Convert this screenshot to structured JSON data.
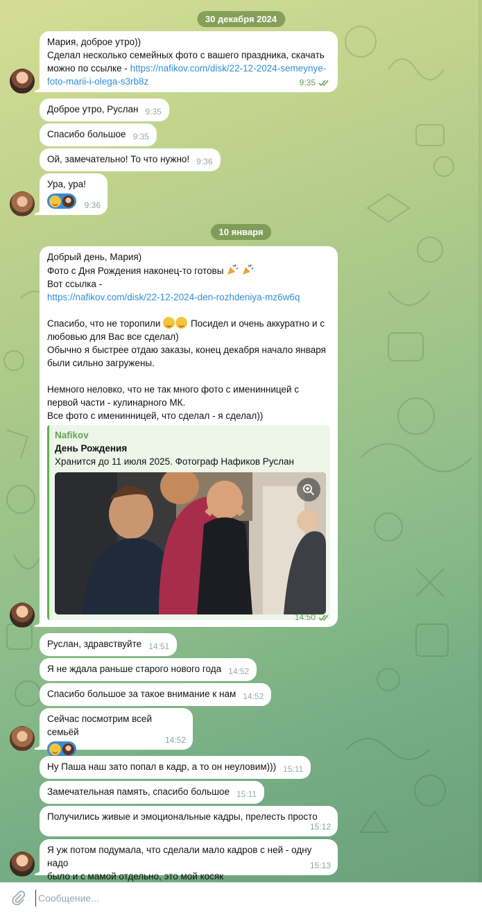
{
  "messages_group_1": {
    "date": "30 декабря 2024",
    "m1": {
      "line1": "Мария, доброе утро))",
      "line2": "Сделал несколько семейных фото с вашего праздника, скачать",
      "line3_prefix": "можно по ссылке - ",
      "link_part1": "https://nafikov.com/disk/22-12-2024-semeynye-",
      "link_part2": "foto-marii-i-olega-s3rb8z",
      "time": "9:35"
    },
    "m2": {
      "text": "Доброе утро, Руслан",
      "time": "9:35"
    },
    "m3": {
      "text": "Спасибо большое",
      "time": "9:35"
    },
    "m4": {
      "text": "Ой, замечательно! То что нужно!",
      "time": "9:36"
    },
    "m5": {
      "text": "Ура, ура!",
      "time": "9:36"
    }
  },
  "messages_group_2": {
    "date": "10 января",
    "m6": {
      "line1": "Добрый день, Мария)",
      "line2": "Фото с Дня Рождения наконец-то готовы",
      "line3": "Вот ссылка -",
      "link": "https://nafikov.com/disk/22-12-2024-den-rozhdeniya-mz6w6q",
      "line5_a": "Спасибо, что не торопили",
      "line5_b": " Посидел и очень аккуратно и с",
      "line6": "любовью для Вас все сделал)",
      "line7": "Обычно я быстрее отдаю заказы,  конец декабря начало января",
      "line8": "были сильно загружены.",
      "line9": "Немного неловко, что не так много  фото с именинницей с",
      "line10": "первой части - кулинарного МК.",
      "line11": "Все фото с именинницей, что сделал - я сделал))",
      "preview_site": "Nafikov",
      "preview_title": "День Рождения",
      "preview_desc": "Хранится до 11 июля 2025. Фотограф Нафиков Руслан",
      "time": "14:50"
    },
    "m7": {
      "text": "Руслан, здравствуйте",
      "time": "14:51"
    },
    "m8": {
      "text": "Я не ждала раньше старого нового года",
      "time": "14:52"
    },
    "m9": {
      "text": "Спасибо большое за такое внимание к нам",
      "time": "14:52"
    },
    "m10": {
      "text": "Сейчас посмотрим всей семьёй",
      "time": "14:52"
    },
    "m11": {
      "text": "Ну Паша наш зато попал в кадр, а то он неуловим)))",
      "time": "15:11"
    },
    "m12": {
      "text": "Замечательная память, спасибо большое",
      "time": "15:11"
    },
    "m13": {
      "text": "Получились живые и эмоциональные кадры, прелесть просто",
      "time": "15:12"
    },
    "m14": {
      "line1": "Я уж потом подумала, что сделали мало кадров с ней - одну надо",
      "line2": "было и с мамой отдельно, это мой косяк",
      "time": "15:13"
    }
  },
  "composer": {
    "placeholder": "Сообщение..."
  },
  "colors": {
    "accent_link": "#2f8fd5",
    "read_check": "#5fa355",
    "date_pill": "#6e8c46",
    "reaction_bg": "#3b8ad0"
  },
  "icons": [
    "double-check-icon",
    "zoom-in-icon",
    "paperclip-icon",
    "party-popper-icon",
    "smiling-face-icon"
  ]
}
